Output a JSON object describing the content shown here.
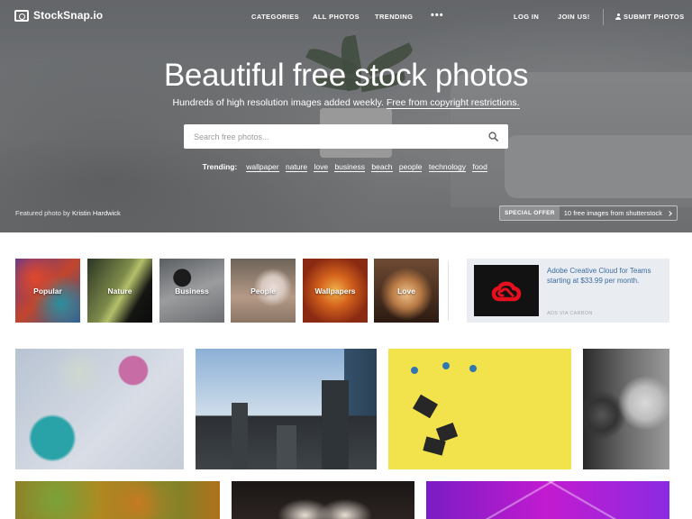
{
  "brand": {
    "name": "StockSnap.io",
    "icon": "camera-icon"
  },
  "nav": {
    "categories": "CATEGORIES",
    "all_photos": "ALL PHOTOS",
    "trending": "TRENDING",
    "more": "•••",
    "login": "LOG IN",
    "join": "JOIN US!",
    "submit": "SUBMIT PHOTOS",
    "submit_icon": "user-icon"
  },
  "hero": {
    "title": "Beautiful free stock photos",
    "subtitle_main": "Hundreds of high resolution images added weekly.",
    "subtitle_link": "Free from copyright restrictions."
  },
  "search": {
    "placeholder": "Search free photos...",
    "icon": "search-icon"
  },
  "trending": {
    "label": "Trending:",
    "tags": [
      "wallpaper",
      "nature",
      "love",
      "business",
      "beach",
      "people",
      "technology",
      "food"
    ]
  },
  "credit": {
    "prefix": "Featured photo by",
    "author": "Kristin Hardwick"
  },
  "offer": {
    "badge": "SPECIAL OFFER",
    "text": "10 free images from shutterstock"
  },
  "categories": [
    "Popular",
    "Nature",
    "Business",
    "People",
    "Wallpapers",
    "Love"
  ],
  "ad": {
    "text": "Adobe Creative Cloud for Teams starting at $33.99 per month.",
    "via": "ADS VIA CARBON",
    "logo": "adobe-creative-cloud-logo"
  },
  "colors": {
    "accent_link": "#3c6ba1",
    "adobe_red": "#e4101e",
    "hero_text": "#ffffff"
  }
}
